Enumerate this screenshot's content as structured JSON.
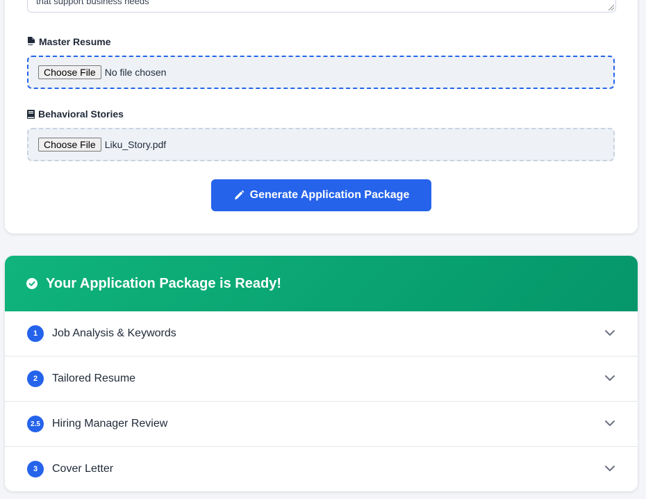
{
  "form": {
    "job_description_text": "position at Director level, which is part of the job family responsible for developing and maintaining software solutions\nthat support business needs",
    "master_resume": {
      "label": "Master Resume",
      "icon": "pdf-file-icon",
      "button_label": "Choose File",
      "file_status": "No file chosen"
    },
    "behavioral_stories": {
      "label": "Behavioral Stories",
      "icon": "book-icon",
      "button_label": "Choose File",
      "file_status": "Liku_Story.pdf"
    },
    "generate_button": {
      "label": "Generate Application Package",
      "icon": "pencil-icon"
    }
  },
  "results": {
    "header_title": "Your Application Package is Ready!",
    "header_icon": "check-circle-icon",
    "sections": [
      {
        "number": "1",
        "title": "Job Analysis & Keywords"
      },
      {
        "number": "2",
        "title": "Tailored Resume"
      },
      {
        "number": "2.5",
        "title": "Hiring Manager Review"
      },
      {
        "number": "3",
        "title": "Cover Letter"
      }
    ]
  },
  "colors": {
    "primary": "#2563eb",
    "success": "#10b47c",
    "page_bg": "#f3f5f8"
  }
}
